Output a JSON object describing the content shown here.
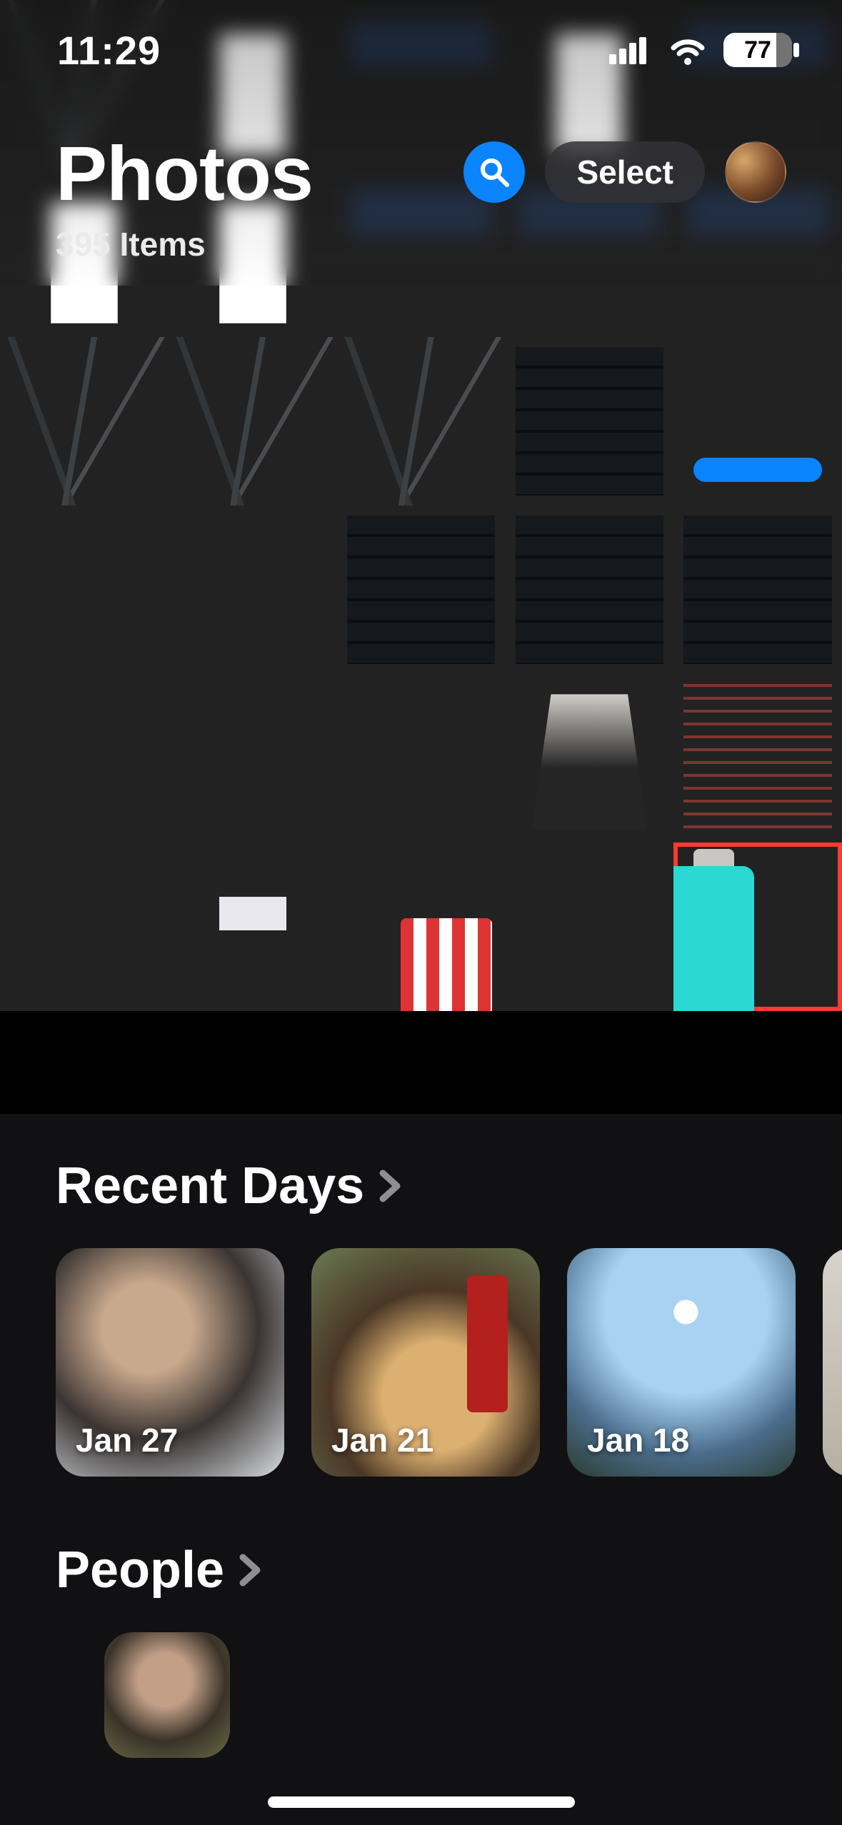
{
  "status": {
    "time": "11:29",
    "battery_percent": "77"
  },
  "header": {
    "title": "Photos",
    "item_count": "395 Items",
    "select_label": "Select"
  },
  "sections": {
    "recent_days_title": "Recent Days",
    "people_title": "People",
    "days": [
      {
        "label": "Jan 27"
      },
      {
        "label": "Jan 21"
      },
      {
        "label": "Jan 18"
      }
    ]
  }
}
